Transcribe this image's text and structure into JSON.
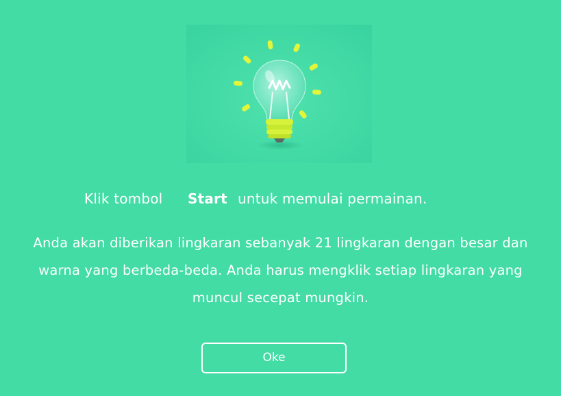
{
  "hero": {
    "icon": "lightbulb-icon"
  },
  "instruction": {
    "prefix": "Klik tombol",
    "keyword": "Start",
    "suffix": "untuk memulai permainan."
  },
  "description": "Anda akan diberikan lingkaran sebanyak 21 lingkaran dengan besar dan warna yang berbeda-beda. Anda harus mengklik setiap lingkaran yang muncul secepat mungkin.",
  "button": {
    "ok_label": "Oke"
  },
  "colors": {
    "background": "#43dca4",
    "text": "#ffffff",
    "accent": "#d8f238"
  }
}
